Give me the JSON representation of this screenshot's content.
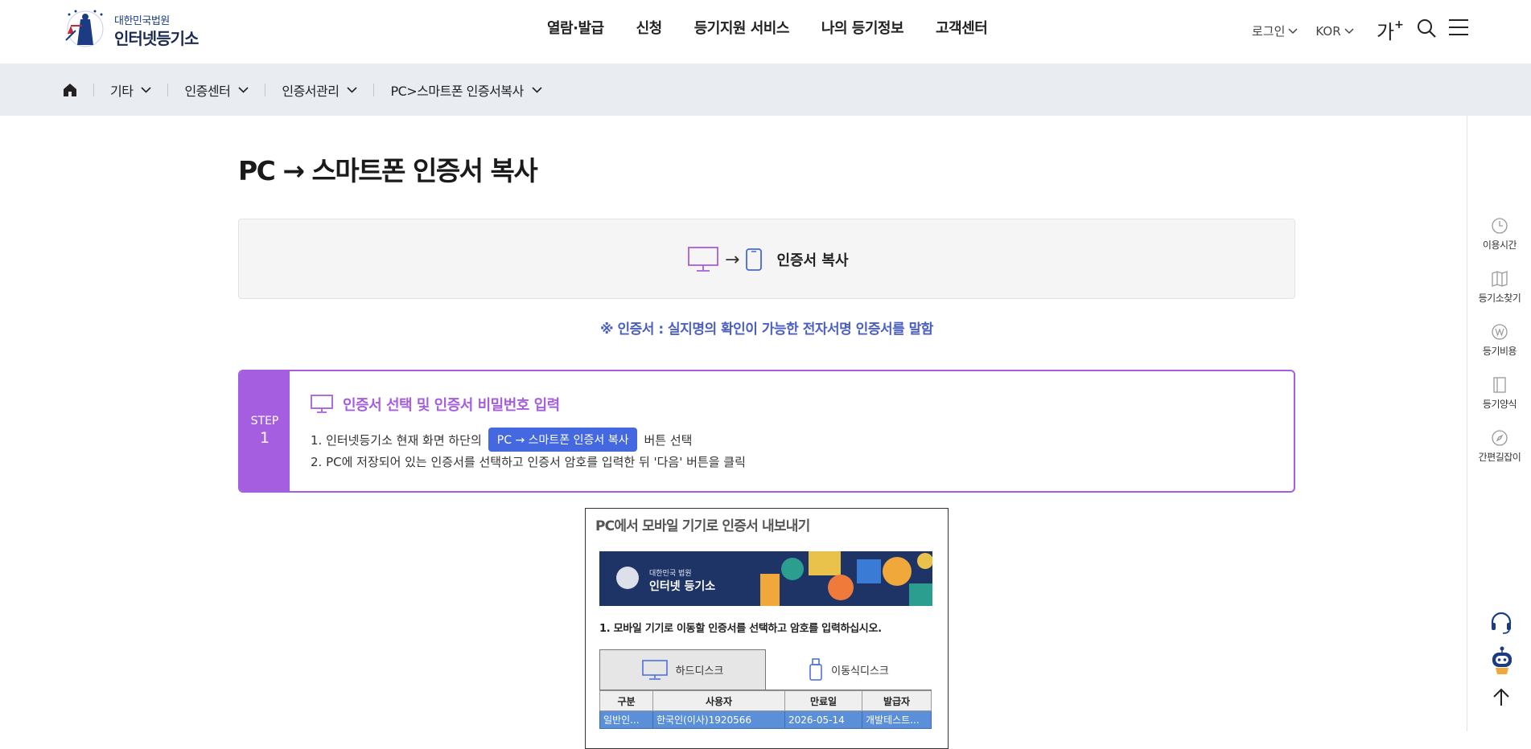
{
  "header": {
    "logo_small": "대한민국법원",
    "logo_big": "인터넷등기소",
    "nav": [
      "열람·발급",
      "신청",
      "등기지원 서비스",
      "나의 등기정보",
      "고객센터"
    ],
    "login": "로그인",
    "language": "KOR",
    "font_size": "가",
    "font_size_plus": "+"
  },
  "breadcrumb": {
    "items": [
      "기타",
      "인증센터",
      "인증서관리",
      "PC>스마트폰 인증서복사"
    ]
  },
  "page": {
    "title": "PC → 스마트폰 인증서 복사",
    "copy_arrow": "→",
    "copy_label": "인증서 복사",
    "note": "※ 인증서 : 실지명의 확인이 가능한 전자서명 인증서를 말함"
  },
  "step": {
    "label": "STEP",
    "number": "1",
    "title": "인증서 선택 및 인증서 비밀번호 입력",
    "line1_before": "1. 인터넷등기소 현재 화면 하단의",
    "line1_button": "PC → 스마트폰 인증서 복사",
    "line1_after": "버튼 선택",
    "line2": "2. PC에 저장되어 있는 인증서를 선택하고 인증서 암호를 입력한 뒤 '다음' 버튼을 클릭"
  },
  "screenshot": {
    "title": "PC에서 모바일 기기로 인증서 내보내기",
    "banner_small": "대한민국 법원",
    "banner_big": "인터넷 등기소",
    "instruction": "1. 모바일 기기로 이동할 인증서를 선택하고 암호를 입력하십시오.",
    "tab_hdd": "하드디스크",
    "tab_usb": "이동식디스크",
    "columns": [
      "구분",
      "사용자",
      "만료일",
      "발급자"
    ],
    "row": [
      "일반인...",
      "한국인(이사)1920566",
      "2026-05-14",
      "개발테스트..."
    ]
  },
  "quick_menu": [
    "이용시간",
    "등기소찾기",
    "등기비용",
    "등기양식",
    "간편길잡이"
  ],
  "colors": {
    "accent_purple": "#a65ee0",
    "accent_blue": "#4468e0",
    "note_blue": "#4a5fc1",
    "crumb_bg": "#e9edf2"
  }
}
